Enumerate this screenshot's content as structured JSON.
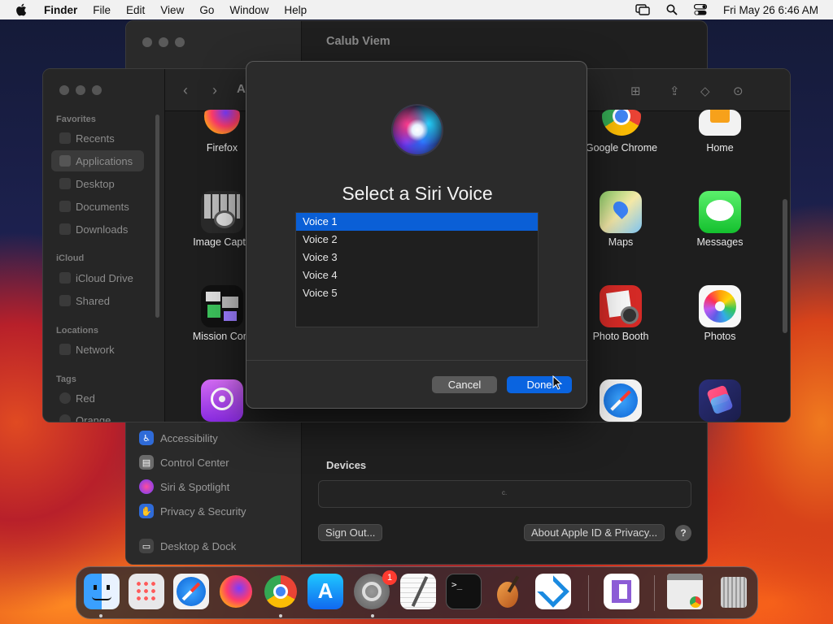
{
  "menubar": {
    "app_name": "Finder",
    "items": [
      "File",
      "Edit",
      "View",
      "Go",
      "Window",
      "Help"
    ],
    "clock": "Fri May 26  6:46 AM"
  },
  "settings": {
    "title": "Calub Viem",
    "sidebar_items": [
      {
        "label": "Accessibility",
        "color": "#2f6bd8"
      },
      {
        "label": "Control Center",
        "color": "#6b6b6b"
      },
      {
        "label": "Siri & Spotlight",
        "color": "#b23aa8"
      },
      {
        "label": "Privacy & Security",
        "color": "#2f6bd8"
      },
      {
        "label": "Desktop & Dock",
        "color": "#444444"
      }
    ],
    "devices_heading": "Devices",
    "devices_placeholder": "c.",
    "sign_out_label": "Sign Out...",
    "about_label": "About Apple ID & Privacy...",
    "help_label": "?"
  },
  "finder": {
    "title_fragment": "A",
    "sidebar": {
      "favorites_heading": "Favorites",
      "favorites": [
        "Recents",
        "Applications",
        "Desktop",
        "Documents",
        "Downloads"
      ],
      "icloud_heading": "iCloud",
      "icloud": [
        "iCloud Drive",
        "Shared"
      ],
      "locations_heading": "Locations",
      "locations": [
        "Network"
      ],
      "tags_heading": "Tags",
      "tags": [
        "Red",
        "Orange"
      ]
    },
    "apps": {
      "firefox": "Firefox",
      "image_capture": "Image Captu",
      "mission_control": "Mission Cont",
      "google_chrome": "Google Chrome",
      "home": "Home",
      "maps": "Maps",
      "messages": "Messages",
      "photo_booth": "Photo Booth",
      "photos": "Photos"
    }
  },
  "dialog": {
    "title": "Select a Siri Voice",
    "voices": [
      "Voice 1",
      "Voice 2",
      "Voice 3",
      "Voice 4",
      "Voice 5"
    ],
    "selected_voice": "Voice 1",
    "cancel_label": "Cancel",
    "done_label": "Done"
  },
  "dock": {
    "badge": "1"
  }
}
